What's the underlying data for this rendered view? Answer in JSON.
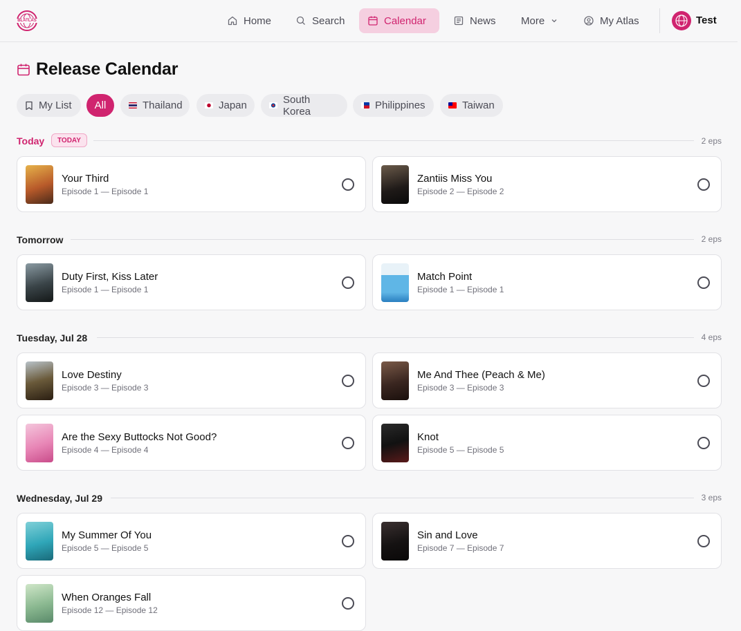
{
  "brand": {
    "logo_text": "BLATLAS"
  },
  "nav": {
    "home": "Home",
    "search": "Search",
    "calendar": "Calendar",
    "news": "News",
    "more": "More",
    "my_atlas": "My Atlas"
  },
  "user": {
    "name": "Test"
  },
  "page": {
    "title": "Release Calendar"
  },
  "filters": {
    "my_list": "My List",
    "all": "All",
    "countries": [
      "Thailand",
      "Japan",
      "South Korea",
      "Philippines",
      "Taiwan"
    ]
  },
  "sections": [
    {
      "label": "Today",
      "badge": "TODAY",
      "count": "2 eps",
      "items": [
        {
          "title": "Your Third",
          "episodes": "Episode 1 — Episode 1"
        },
        {
          "title": "Zantiis Miss You",
          "episodes": "Episode 2 — Episode 2"
        }
      ]
    },
    {
      "label": "Tomorrow",
      "count": "2 eps",
      "items": [
        {
          "title": "Duty First, Kiss Later",
          "episodes": "Episode 1 — Episode 1"
        },
        {
          "title": "Match Point",
          "episodes": "Episode 1 — Episode 1"
        }
      ]
    },
    {
      "label": "Tuesday, Jul 28",
      "count": "4 eps",
      "items": [
        {
          "title": "Love Destiny",
          "episodes": "Episode 3 — Episode 3"
        },
        {
          "title": "Me And Thee (Peach & Me)",
          "episodes": "Episode 3 — Episode 3"
        },
        {
          "title": "Are the Sexy Buttocks Not Good?",
          "episodes": "Episode 4 — Episode 4"
        },
        {
          "title": "Knot",
          "episodes": "Episode 5 — Episode 5"
        }
      ]
    },
    {
      "label": "Wednesday, Jul 29",
      "count": "3 eps",
      "items": [
        {
          "title": "My Summer Of You",
          "episodes": "Episode 5 — Episode 5"
        },
        {
          "title": "Sin and Love",
          "episodes": "Episode 7 — Episode 7"
        },
        {
          "title": "When Oranges Fall",
          "episodes": "Episode 12 — Episode 12"
        }
      ]
    }
  ],
  "colors": {
    "accent": "#d0246f",
    "accent_soft": "#f5cfe0",
    "background": "#f7f7f8"
  }
}
